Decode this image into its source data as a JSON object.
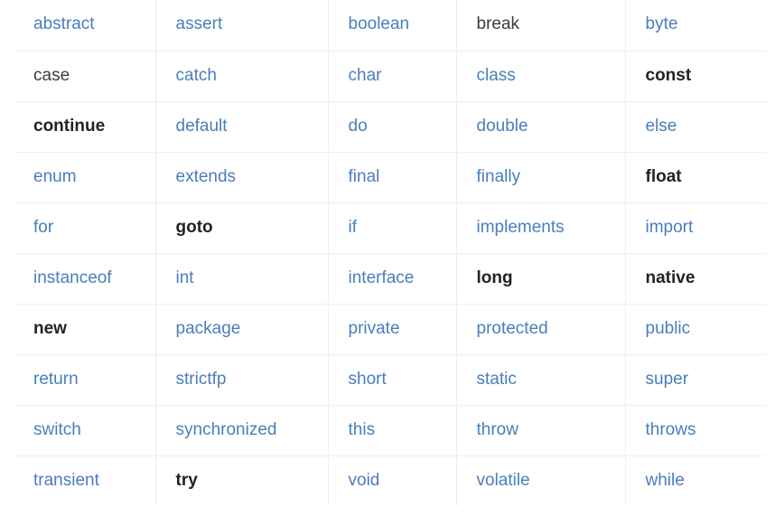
{
  "table": {
    "colors": {
      "link": "#4a7ebb",
      "plain_text": "#3c3c3c",
      "strong_text": "#232323",
      "row_divider": "#eceff1",
      "column_divider": "#ebeef0",
      "background": "#ffffff"
    },
    "columns": 5,
    "rows": [
      [
        {
          "text": "abstract",
          "style": "link"
        },
        {
          "text": "assert",
          "style": "link"
        },
        {
          "text": "boolean",
          "style": "link"
        },
        {
          "text": "break",
          "style": "plain"
        },
        {
          "text": "byte",
          "style": "link"
        }
      ],
      [
        {
          "text": "case",
          "style": "plain"
        },
        {
          "text": "catch",
          "style": "link"
        },
        {
          "text": "char",
          "style": "link"
        },
        {
          "text": "class",
          "style": "link"
        },
        {
          "text": "const",
          "style": "strong"
        }
      ],
      [
        {
          "text": "continue",
          "style": "strong"
        },
        {
          "text": "default",
          "style": "link"
        },
        {
          "text": "do",
          "style": "link"
        },
        {
          "text": "double",
          "style": "link"
        },
        {
          "text": "else",
          "style": "link"
        }
      ],
      [
        {
          "text": "enum",
          "style": "link"
        },
        {
          "text": "extends",
          "style": "link"
        },
        {
          "text": "final",
          "style": "link"
        },
        {
          "text": "finally",
          "style": "link"
        },
        {
          "text": "float",
          "style": "strong"
        }
      ],
      [
        {
          "text": "for",
          "style": "link"
        },
        {
          "text": "goto",
          "style": "strong"
        },
        {
          "text": "if",
          "style": "link"
        },
        {
          "text": "implements",
          "style": "link"
        },
        {
          "text": "import",
          "style": "link"
        }
      ],
      [
        {
          "text": "instanceof",
          "style": "link"
        },
        {
          "text": "int",
          "style": "link"
        },
        {
          "text": "interface",
          "style": "link"
        },
        {
          "text": "long",
          "style": "strong"
        },
        {
          "text": "native",
          "style": "strong"
        }
      ],
      [
        {
          "text": "new",
          "style": "strong"
        },
        {
          "text": "package",
          "style": "link"
        },
        {
          "text": "private",
          "style": "link"
        },
        {
          "text": "protected",
          "style": "link"
        },
        {
          "text": "public",
          "style": "link"
        }
      ],
      [
        {
          "text": "return",
          "style": "link"
        },
        {
          "text": "strictfp",
          "style": "link"
        },
        {
          "text": "short",
          "style": "link"
        },
        {
          "text": "static",
          "style": "link"
        },
        {
          "text": "super",
          "style": "link"
        }
      ],
      [
        {
          "text": "switch",
          "style": "link"
        },
        {
          "text": "synchronized",
          "style": "link"
        },
        {
          "text": "this",
          "style": "link"
        },
        {
          "text": "throw",
          "style": "link"
        },
        {
          "text": "throws",
          "style": "link"
        }
      ],
      [
        {
          "text": "transient",
          "style": "link"
        },
        {
          "text": "try",
          "style": "strong"
        },
        {
          "text": "void",
          "style": "link"
        },
        {
          "text": "volatile",
          "style": "link"
        },
        {
          "text": "while",
          "style": "link"
        }
      ]
    ]
  }
}
